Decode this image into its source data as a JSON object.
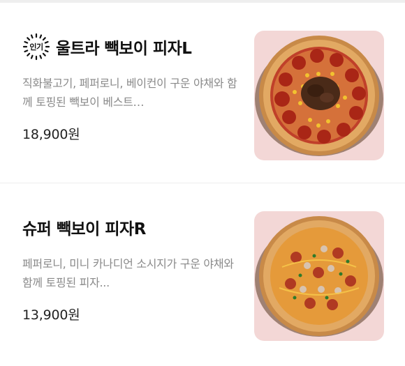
{
  "items": [
    {
      "badge": "인기",
      "title": "울트라 빽보이 피자L",
      "description": "직화불고기, 페퍼로니, 베이컨이 구운 야채와 함께 토핑된 빽보이 베스트…",
      "price": "18,900원",
      "image_icon": "pizza-bulgogi-image"
    },
    {
      "title": "슈퍼 빽보이 피자R",
      "description": "페퍼로니, 미니 카나디언 소시지가 구운 야채와 함께 토핑된 피자...",
      "price": "13,900원",
      "image_icon": "pizza-sausage-image"
    }
  ],
  "colors": {
    "thumb_bg": "#f3d7d6",
    "crust": "#d39a52",
    "sauce": "#b8351f",
    "pepperoni": "#b02a1a",
    "bulgogi": "#4a2a18",
    "corn": "#f2c230",
    "cheese": "#f0a93a"
  }
}
